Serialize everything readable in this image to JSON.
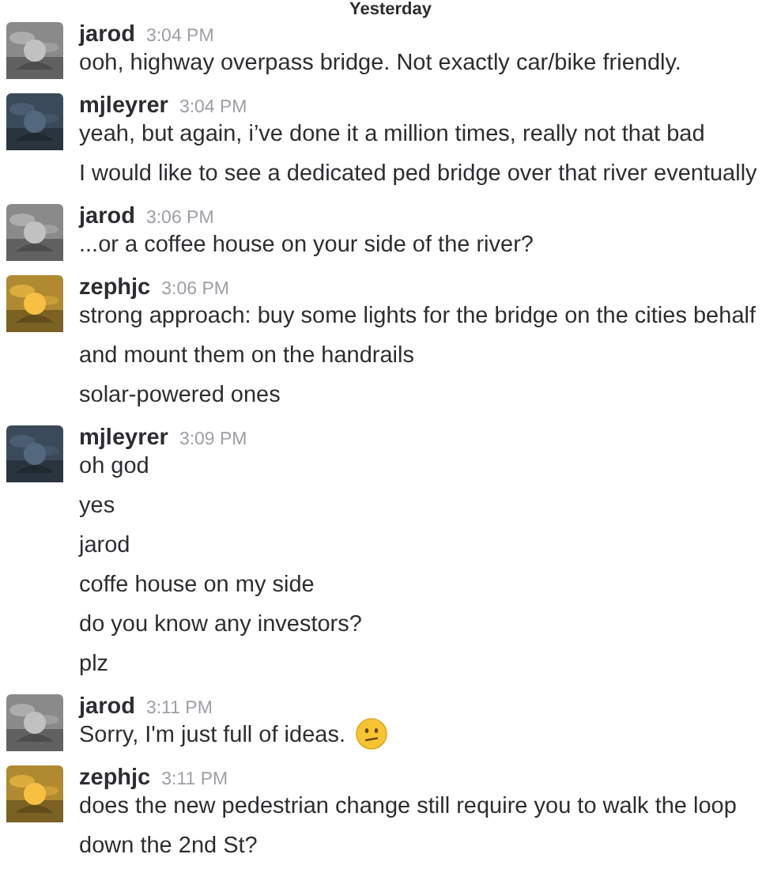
{
  "day_divider": "Yesterday",
  "groups": [
    {
      "user": "jarod",
      "time": "3:04 PM",
      "avatar": {
        "kind": "picture",
        "color": "#8a8a8a"
      },
      "messages": [
        {
          "text": "ooh, highway overpass bridge. Not exactly car/bike friendly."
        }
      ]
    },
    {
      "user": "mjleyrer",
      "time": "3:04 PM",
      "avatar": {
        "kind": "picture",
        "color": "#3b4a5a"
      },
      "messages": [
        {
          "text": "yeah, but again, i’ve done it a million times, really not that bad"
        },
        {
          "text": "I would like to see a dedicated ped bridge over that river eventually"
        }
      ]
    },
    {
      "user": "jarod",
      "time": "3:06 PM",
      "avatar": {
        "kind": "picture",
        "color": "#8a8a8a"
      },
      "messages": [
        {
          "text": "...or a coffee house on your side of the river?"
        }
      ]
    },
    {
      "user": "zephjc",
      "time": "3:06 PM",
      "avatar": {
        "kind": "picture",
        "color": "#b08a30"
      },
      "messages": [
        {
          "text": "strong approach: buy some lights for the bridge on the cities behalf and mount them on the handrails"
        },
        {
          "text": "solar-powered ones"
        }
      ]
    },
    {
      "user": "mjleyrer",
      "time": "3:09 PM",
      "avatar": {
        "kind": "picture",
        "color": "#3b4a5a"
      },
      "messages": [
        {
          "text": "oh god"
        },
        {
          "text": "yes"
        },
        {
          "text": "jarod"
        },
        {
          "text": "coffe house on my side"
        },
        {
          "text": "do you know any investors?"
        },
        {
          "text": "plz"
        }
      ]
    },
    {
      "user": "jarod",
      "time": "3:11 PM",
      "avatar": {
        "kind": "picture",
        "color": "#8a8a8a"
      },
      "messages": [
        {
          "text": "Sorry, I'm just full of ideas.",
          "emoji": true
        }
      ]
    },
    {
      "user": "zephjc",
      "time": "3:11 PM",
      "avatar": {
        "kind": "picture",
        "color": "#b08a30"
      },
      "messages": [
        {
          "text": "does the new pedestrian change still require you to walk the loop down the 2nd St?"
        }
      ]
    }
  ]
}
